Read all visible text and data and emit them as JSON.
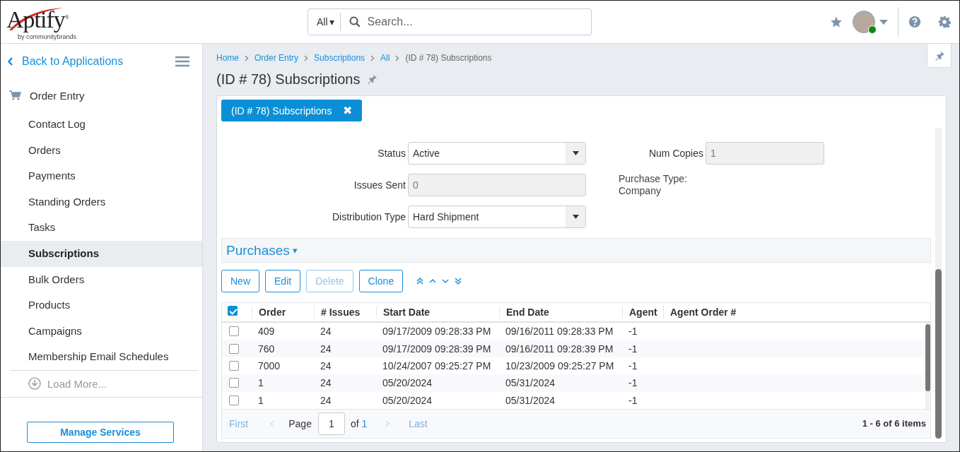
{
  "header": {
    "logo": {
      "name": "Aptify$^{®}$",
      "tagline": "by communitybrands"
    },
    "search": {
      "scope": "All",
      "scope_caret": "▾",
      "placeholder": "Search..."
    },
    "user": {
      "online": true
    }
  },
  "sidebar": {
    "back": "Back to Applications",
    "app": {
      "label": "Order Entry",
      "children": [
        {
          "label": "Contact Log",
          "selected": false
        },
        {
          "label": "Orders",
          "selected": false
        },
        {
          "label": "Payments",
          "selected": false
        },
        {
          "label": "Standing Orders",
          "selected": false
        },
        {
          "label": "Tasks",
          "selected": false
        },
        {
          "label": "Subscriptions",
          "selected": true
        },
        {
          "label": "Bulk Orders",
          "selected": false
        },
        {
          "label": "Products",
          "selected": false
        },
        {
          "label": "Campaigns",
          "selected": false
        },
        {
          "label": "Membership Email Schedules",
          "selected": false
        }
      ]
    },
    "load_more": "Load More...",
    "manage_button": "Manage Services"
  },
  "breadcrumb": [
    {
      "label": "Home",
      "current": false
    },
    {
      "label": "Order Entry",
      "current": false
    },
    {
      "label": "Subscriptions",
      "current": false
    },
    {
      "label": "All",
      "current": false
    },
    {
      "label": "(ID # 78) Subscriptions",
      "current": true
    }
  ],
  "page_title": "(ID # 78) Subscriptions",
  "record_tab": {
    "label": "(ID # 78) Subscriptions",
    "close": "✖"
  },
  "form": {
    "fields": [
      {
        "kind": "select",
        "label": "Status",
        "value": "Active",
        "disabled": false
      },
      {
        "kind": "input",
        "label": "Num Copies",
        "value": "1",
        "disabled": true
      },
      {
        "kind": "input",
        "label": "Issues Sent",
        "value": "0",
        "disabled": true
      },
      {
        "kind": "text",
        "label": "Purchase Type:",
        "value": "Company"
      },
      {
        "kind": "select",
        "label": "Distribution Type",
        "value": "Hard Shipment",
        "disabled": false
      }
    ]
  },
  "section": {
    "title": "Purchases",
    "caret": "▾",
    "expanded": true
  },
  "toolbar": {
    "buttons": [
      {
        "label": "New",
        "disabled": false
      },
      {
        "label": "Edit",
        "disabled": false
      },
      {
        "label": "Delete",
        "disabled": true
      },
      {
        "label": "Clone",
        "disabled": false
      }
    ]
  },
  "table": {
    "select_all_checked": true,
    "columns": [
      "Order",
      "# Issues",
      "Start Date",
      "End Date",
      "Agent",
      "Agent Order #"
    ],
    "rows": [
      {
        "checked": false,
        "cells": [
          "409",
          "24",
          "09/17/2009 09:28:33 PM",
          "09/16/2011 09:28:33 PM",
          "-1",
          ""
        ]
      },
      {
        "checked": false,
        "cells": [
          "760",
          "24",
          "09/17/2009 09:28:39 PM",
          "09/16/2011 09:28:39 PM",
          "-1",
          ""
        ]
      },
      {
        "checked": false,
        "cells": [
          "7000",
          "24",
          "10/24/2007 09:25:27 PM",
          "10/23/2009 09:25:27 PM",
          "-1",
          ""
        ]
      },
      {
        "checked": false,
        "cells": [
          "1",
          "24",
          "05/20/2024",
          "05/31/2024",
          "-1",
          ""
        ]
      },
      {
        "checked": false,
        "cells": [
          "1",
          "24",
          "05/20/2024",
          "05/31/2024",
          "-1",
          ""
        ]
      }
    ]
  },
  "pager": {
    "first": {
      "label": "First",
      "disabled": true
    },
    "prev_disabled": true,
    "page_label": "Page",
    "page": "1",
    "of": "of",
    "total": "1",
    "next_disabled": true,
    "last": {
      "label": "Last",
      "disabled": true
    },
    "summary": "1 - 6 of 6 items"
  }
}
